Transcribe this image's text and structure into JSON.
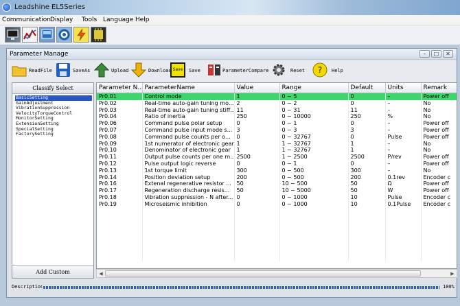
{
  "window": {
    "title": "Leadshine EL5Series"
  },
  "menu": [
    "Communication",
    "Display",
    "Tools",
    "Language",
    "Help"
  ],
  "main_toolbar": [
    "monitor-icon",
    "chart-icon",
    "screen-icon",
    "target-icon",
    "lightning-icon",
    "chip-icon"
  ],
  "child_window": {
    "title": "Parameter Manage",
    "toolbar": {
      "read_file": "ReadFile",
      "save_as": "SaveAs",
      "upload": "Upload",
      "download": "Download",
      "save_icon_text": "Save",
      "save": "Save",
      "parameter_compare": "ParameterCompare",
      "reset": "Reset",
      "help": "Help"
    }
  },
  "classify": {
    "header": "Classify Select",
    "items": [
      "BasicSetting",
      "GainAdjustment",
      "VibrationSuppression",
      "VelocityTorqueControl",
      "MonitorSetting",
      "ExtensionSetting",
      "SpecialSetting",
      "FactorySetting"
    ],
    "selected_index": 0,
    "add_custom": "Add Custom"
  },
  "table": {
    "columns": [
      "Parameter N...",
      "ParameterName",
      "Value",
      "Range",
      "Default",
      "Units",
      "Remark"
    ],
    "selected_row": 0,
    "rows": [
      [
        "Pr0.01",
        "Control mode",
        "1",
        "0 ~ 5",
        "0",
        "–",
        "Power off"
      ],
      [
        "Pr0.02",
        "Real-time auto-gain tuning mo...",
        "2",
        "0 ~ 2",
        "0",
        "–",
        "No"
      ],
      [
        "Pr0.03",
        "Real-time auto-gain tuning stiff...",
        "11",
        "0 ~ 31",
        "11",
        "–",
        "No"
      ],
      [
        "Pr0.04",
        "Ratio of inertia",
        "250",
        "0 ~ 10000",
        "250",
        "%",
        "No"
      ],
      [
        "Pr0.06",
        "Command pulse polar setup",
        "0",
        "0 ~ 1",
        "0",
        "–",
        "Power off"
      ],
      [
        "Pr0.07",
        "Command pulse input mode s...",
        "3",
        "0 ~ 3",
        "3",
        "–",
        "Power off"
      ],
      [
        "Pr0.08",
        "Command pulse counts per o...",
        "0",
        "0 ~ 32767",
        "0",
        "Pulse",
        "Power off"
      ],
      [
        "Pr0.09",
        "1st numerator of electronic gear",
        "1",
        "1 ~ 32767",
        "1",
        "–",
        "No"
      ],
      [
        "Pr0.10",
        "Denominator of electronic gear",
        "1",
        "1 ~ 32767",
        "1",
        "–",
        "No"
      ],
      [
        "Pr0.11",
        "Output pulse counts per one m...",
        "2500",
        "1 ~ 2500",
        "2500",
        "P/rev",
        "Power off"
      ],
      [
        "Pr0.12",
        "Pulse output logic reverse",
        "0",
        "0 ~ 1",
        "0",
        "–",
        "Power off"
      ],
      [
        "Pr0.13",
        "1st torque limit",
        "300",
        "0 ~ 500",
        "300",
        "–",
        "No"
      ],
      [
        "Pr0.14",
        "Position deviation setup",
        "200",
        "0 ~ 500",
        "200",
        "0.1rev",
        "Encoder c"
      ],
      [
        "Pr0.16",
        "Extenal regenerative resistor ...",
        "50",
        "10 ~ 500",
        "50",
        "Ω",
        "Power off"
      ],
      [
        "Pr0.17",
        "Regeneration discharge resis...",
        "50",
        "10 ~ 5000",
        "50",
        "W",
        "Power off"
      ],
      [
        "Pr0.18",
        "Vibration suppression - N after...",
        "0",
        "0 ~ 1000",
        "10",
        "Pulse",
        "Encoder c"
      ],
      [
        "Pr0.19",
        "Microseismic inhibition",
        "0",
        "0 ~ 1000",
        "10",
        "0.1Pulse",
        "Encoder c"
      ]
    ]
  },
  "status": {
    "description_label": "Description:",
    "progress_percent": 100,
    "progress_text": "100%"
  },
  "colors": {
    "selected_row": "#3ed56b",
    "selected_tree": "#2a55c9",
    "progress": "#2c63d8"
  }
}
